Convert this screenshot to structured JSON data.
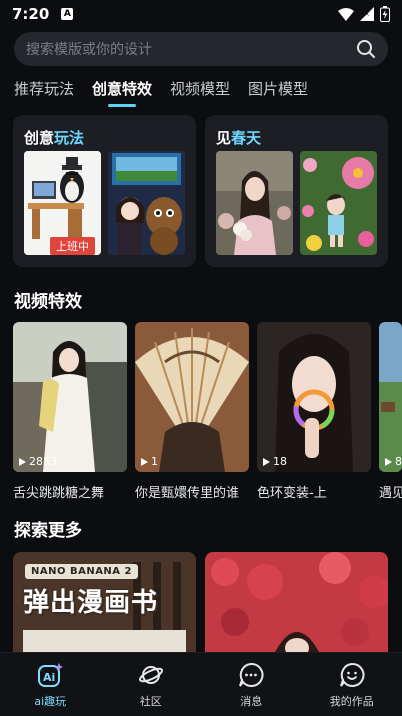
{
  "status": {
    "time": "7:20",
    "notif": "A"
  },
  "search": {
    "placeholder": "搜索模版或你的设计"
  },
  "tabs": [
    {
      "label": "推荐玩法"
    },
    {
      "label": "创意特效"
    },
    {
      "label": "视频模型"
    },
    {
      "label": "图片模型"
    }
  ],
  "cards": {
    "creative": {
      "title_a": "创意",
      "title_b": "玩法",
      "tag": "上班中"
    },
    "spring": {
      "title_a": "见",
      "title_b": "春天"
    }
  },
  "video_section": {
    "title": "视频特效"
  },
  "videos": [
    {
      "count": "2853",
      "title": "舌尖跳跳糖之舞"
    },
    {
      "count": "1",
      "title": "你是甄嬛传里的谁"
    },
    {
      "count": "18",
      "title": "色环变装-上"
    },
    {
      "count": "8",
      "title": "遇见"
    }
  ],
  "explore_section": {
    "title": "探索更多"
  },
  "explore": {
    "tag": "NANO BANANA 2",
    "headline": "弹出漫画书"
  },
  "nav": [
    {
      "label": "ai趣玩"
    },
    {
      "label": "社区"
    },
    {
      "label": "消息"
    },
    {
      "label": "我的作品"
    }
  ],
  "colors": {
    "accent": "#5fd0ff",
    "background": "#0c0d10",
    "card": "#1c1e23",
    "tag_red": "#e0453b"
  }
}
